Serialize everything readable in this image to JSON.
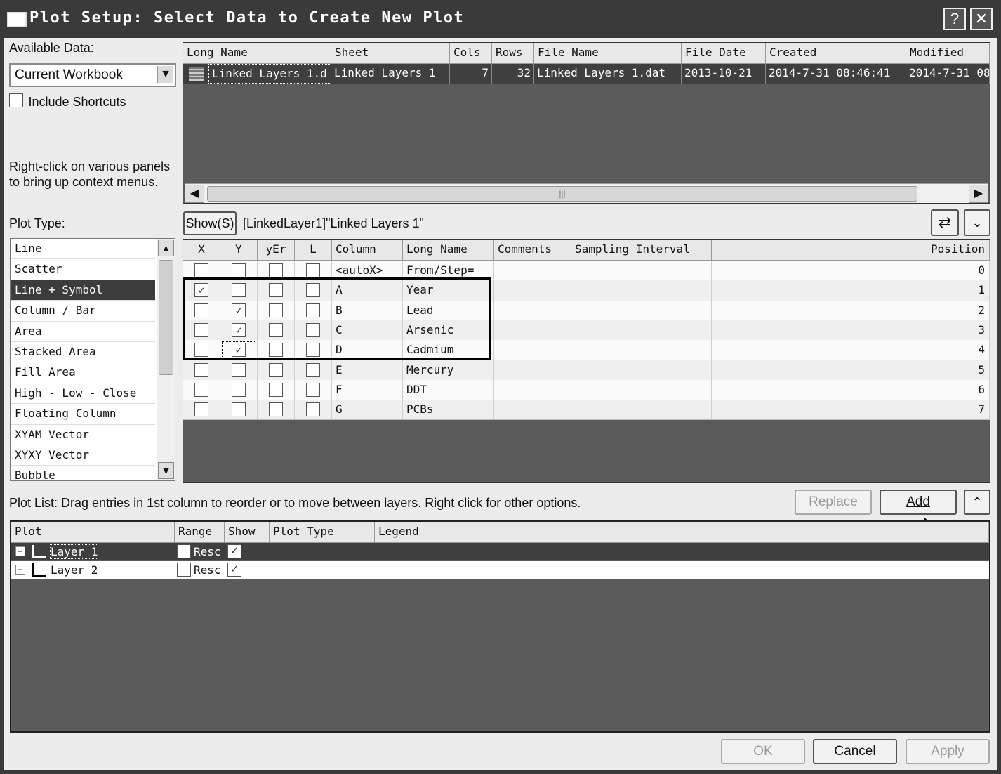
{
  "window": {
    "title": "Plot Setup: Select Data to Create New Plot",
    "help_label": "?",
    "close_label": "✕"
  },
  "available": {
    "label": "Available Data:",
    "selected": "Current Workbook",
    "include_shortcuts": "Include Shortcuts",
    "hint": "Right-click on various panels to bring up context menus."
  },
  "datasets": {
    "headers": [
      "Long Name",
      "Sheet",
      "Cols",
      "Rows",
      "File Name",
      "File Date",
      "Created",
      "Modified"
    ],
    "row": [
      "Linked Layers 1.d",
      "Linked Layers 1",
      "7",
      "32",
      "Linked Layers 1.dat",
      "2013-10-21",
      "2014-7-31 08:46:41",
      "2014-7-31 08"
    ]
  },
  "plot_type": {
    "label": "Plot Type:",
    "items": [
      "Line",
      "Scatter",
      "Line + Symbol",
      "Column / Bar",
      "Area",
      "Stacked Area",
      "Fill Area",
      "High - Low - Close",
      "Floating Column",
      "XYAM Vector",
      "XYXY Vector",
      "Bubble"
    ],
    "selected_index": 2
  },
  "columns": {
    "show_button": "Show(S)",
    "source": "[LinkedLayer1]\"Linked Layers 1\"",
    "headers": [
      "X",
      "Y",
      "yEr",
      "L",
      "Column",
      "Long Name",
      "Comments",
      "Sampling Interval",
      "Position"
    ],
    "rows": [
      {
        "x": false,
        "y": false,
        "column": "<autoX>",
        "long_name": "From/Step=",
        "position": "0"
      },
      {
        "x": true,
        "y": false,
        "column": "A",
        "long_name": "Year",
        "position": "1"
      },
      {
        "x": false,
        "y": true,
        "column": "B",
        "long_name": "Lead",
        "position": "2"
      },
      {
        "x": false,
        "y": true,
        "column": "C",
        "long_name": "Arsenic",
        "position": "3"
      },
      {
        "x": false,
        "y": true,
        "column": "D",
        "long_name": "Cadmium",
        "position": "4"
      },
      {
        "x": false,
        "y": false,
        "column": "E",
        "long_name": "Mercury",
        "position": "5"
      },
      {
        "x": false,
        "y": false,
        "column": "F",
        "long_name": "DDT",
        "position": "6"
      },
      {
        "x": false,
        "y": false,
        "column": "G",
        "long_name": "PCBs",
        "position": "7"
      }
    ]
  },
  "plot_list": {
    "hint": "Plot List: Drag entries in 1st column to reorder or to move between layers. Right click for other options.",
    "replace_label": "Replace",
    "add_label": "Add",
    "headers": [
      "Plot",
      "Range",
      "Show",
      "Plot Type",
      "Legend"
    ],
    "layers": [
      {
        "name": "Layer 1",
        "range": "Resc",
        "show": true
      },
      {
        "name": "Layer 2",
        "range": "Resc",
        "show": true
      }
    ]
  },
  "footer": {
    "ok_label": "OK",
    "cancel_label": "Cancel",
    "apply_label": "Apply"
  }
}
